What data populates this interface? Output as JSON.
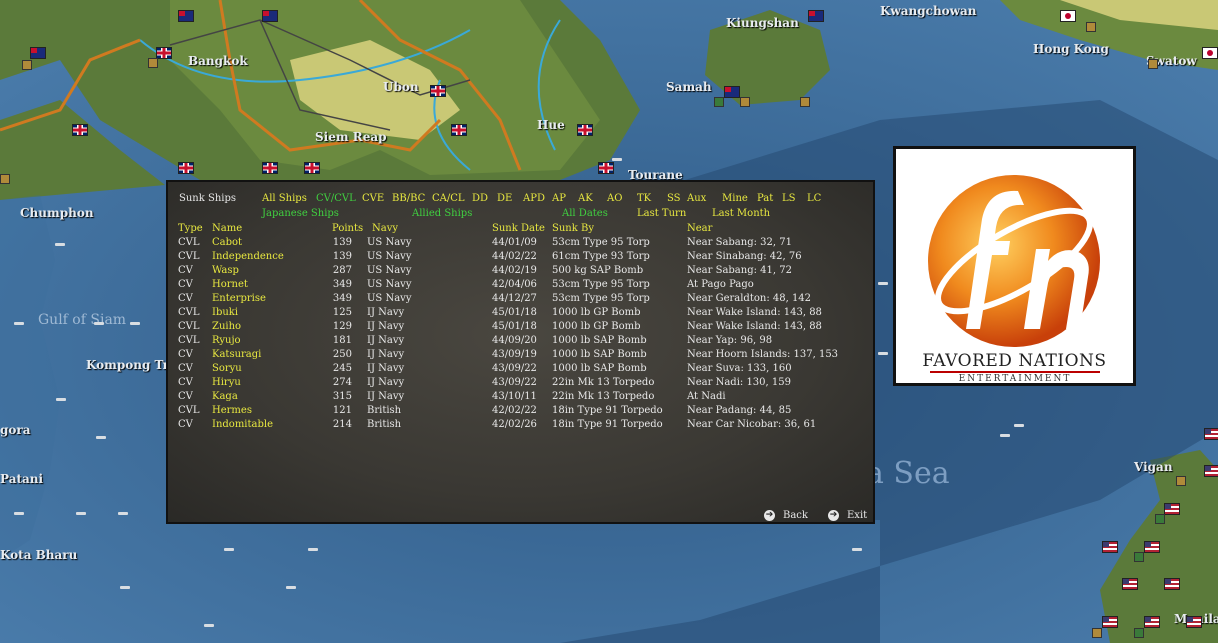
{
  "map": {
    "places": [
      {
        "name": "Bangkok"
      },
      {
        "name": "Ubon"
      },
      {
        "name": "Siem Reap"
      },
      {
        "name": "Hue"
      },
      {
        "name": "Tourane"
      },
      {
        "name": "Kiungshan"
      },
      {
        "name": "Kwangchowan"
      },
      {
        "name": "Hong Kong"
      },
      {
        "name": "Swatow"
      },
      {
        "name": "Samah"
      },
      {
        "name": "Chumphon"
      },
      {
        "name": "Gulf of Siam"
      },
      {
        "name": "Kompong Tra"
      },
      {
        "name": "gora"
      },
      {
        "name": "Patani"
      },
      {
        "name": "Kota Bharu"
      },
      {
        "name": "Vigan"
      },
      {
        "name": "Manila"
      },
      {
        "name": "a Sea"
      }
    ]
  },
  "dialog": {
    "title": "Sunk Ships",
    "filters_row1": [
      "All Ships",
      "CV/CVL",
      "CVE",
      "BB/BC",
      "CA/CL",
      "DD",
      "DE",
      "APD",
      "AP",
      "AK",
      "AO",
      "TK",
      "SS",
      "Aux",
      "Mine",
      "Pat",
      "LS",
      "LC"
    ],
    "filters_row2": [
      "Japanese Ships",
      "Allied Ships",
      "All Dates",
      "Last Turn",
      "Last Month"
    ],
    "columns": {
      "type": "Type",
      "name": "Name",
      "points": "Points",
      "navy": "Navy",
      "date": "Sunk Date",
      "by": "Sunk By",
      "near": "Near"
    },
    "rows": [
      {
        "type": "CVL",
        "name": "Cabot",
        "points": "139",
        "navy": "US Navy",
        "date": "44/01/09",
        "by": "53cm Type 95 Torp",
        "near": "Near Sabang: 32, 71"
      },
      {
        "type": "CVL",
        "name": "Independence",
        "points": "139",
        "navy": "US Navy",
        "date": "44/02/22",
        "by": "61cm Type 93 Torp",
        "near": "Near Sinabang: 42, 76"
      },
      {
        "type": "CV",
        "name": "Wasp",
        "points": "287",
        "navy": "US Navy",
        "date": "44/02/19",
        "by": "500 kg SAP Bomb",
        "near": "Near Sabang: 41, 72"
      },
      {
        "type": "CV",
        "name": "Hornet",
        "points": "349",
        "navy": "US Navy",
        "date": "42/04/06",
        "by": "53cm Type 95 Torp",
        "near": "At Pago Pago"
      },
      {
        "type": "CV",
        "name": "Enterprise",
        "points": "349",
        "navy": "US Navy",
        "date": "44/12/27",
        "by": "53cm Type 95 Torp",
        "near": "Near Geraldton: 48, 142"
      },
      {
        "type": "CVL",
        "name": "Ibuki",
        "points": "125",
        "navy": "IJ Navy",
        "date": "45/01/18",
        "by": "1000 lb GP Bomb",
        "near": "Near Wake Island: 143, 88"
      },
      {
        "type": "CVL",
        "name": "Zuiho",
        "points": "129",
        "navy": "IJ Navy",
        "date": "45/01/18",
        "by": "1000 lb GP Bomb",
        "near": "Near Wake Island: 143, 88"
      },
      {
        "type": "CVL",
        "name": "Ryujo",
        "points": "181",
        "navy": "IJ Navy",
        "date": "44/09/20",
        "by": "1000 lb SAP Bomb",
        "near": "Near Yap: 96, 98"
      },
      {
        "type": "CV",
        "name": "Katsuragi",
        "points": "250",
        "navy": "IJ Navy",
        "date": "43/09/19",
        "by": "1000 lb SAP Bomb",
        "near": "Near Hoorn Islands: 137, 153"
      },
      {
        "type": "CV",
        "name": "Soryu",
        "points": "245",
        "navy": "IJ Navy",
        "date": "43/09/22",
        "by": "1000 lb SAP Bomb",
        "near": "Near Suva: 133, 160"
      },
      {
        "type": "CV",
        "name": "Hiryu",
        "points": "274",
        "navy": "IJ Navy",
        "date": "43/09/22",
        "by": "22in Mk 13 Torpedo",
        "near": "Near Nadi: 130, 159"
      },
      {
        "type": "CV",
        "name": "Kaga",
        "points": "315",
        "navy": "IJ Navy",
        "date": "43/10/11",
        "by": "22in Mk 13 Torpedo",
        "near": "At Nadi"
      },
      {
        "type": "CVL",
        "name": "Hermes",
        "points": "121",
        "navy": "British",
        "date": "42/02/22",
        "by": "18in Type 91 Torpedo",
        "near": "Near Padang: 44, 85"
      },
      {
        "type": "CV",
        "name": "Indomitable",
        "points": "214",
        "navy": "British",
        "date": "42/02/26",
        "by": "18in Type 91 Torpedo",
        "near": "Near Car Nicobar: 36, 61"
      }
    ],
    "buttons": {
      "back": "Back",
      "exit": "Exit"
    }
  },
  "logo": {
    "line1": "FAVORED NATIONS",
    "line2": "ENTERTAINMENT"
  }
}
